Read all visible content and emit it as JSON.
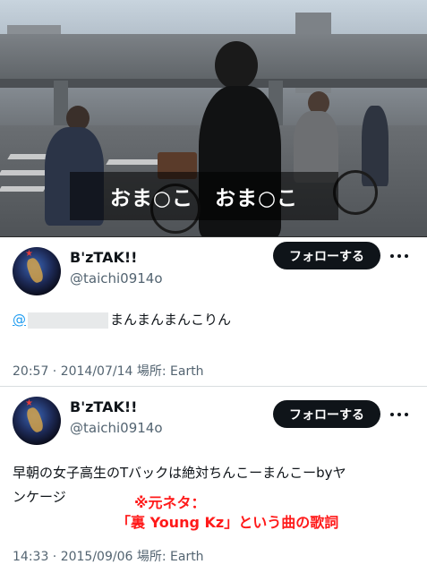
{
  "video": {
    "caption": "おま○こ　おま○こ"
  },
  "tweets": [
    {
      "display_name": "B'zTAK!!",
      "handle": "@taichi0914o",
      "follow_label": "フォローする",
      "more_icon": "more-icon",
      "mention_prefix": "@",
      "text": "まんまんまんこりん",
      "timestamp": "20:57 · 2014/07/14",
      "location_label": "場所:",
      "location": "Earth"
    },
    {
      "display_name": "B'zTAK!!",
      "handle": "@taichi0914o",
      "follow_label": "フォローする",
      "more_icon": "more-icon",
      "text_line1": "早朝の女子高生のTバックは絶対ちんこーまんこーbyヤ",
      "text_line2": "ンケージ",
      "annotation_line1": "※元ネタ：",
      "annotation_line2": "「裏 Young Kz」という曲の歌詞",
      "timestamp": "14:33 · 2015/09/06",
      "location_label": "場所:",
      "location": "Earth"
    }
  ],
  "colors": {
    "follow_bg": "#0f1419",
    "mention": "#1d9bf0",
    "annotation": "#ff1a1a",
    "secondary_text": "#536471"
  }
}
